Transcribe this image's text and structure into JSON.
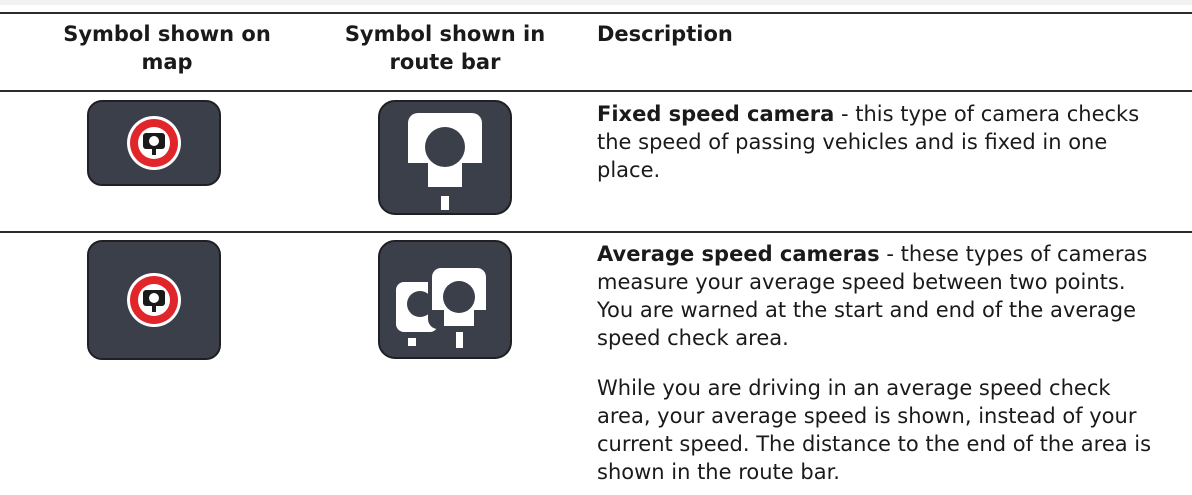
{
  "table": {
    "headers": {
      "map_symbol": "Symbol shown on map",
      "route_bar_symbol": "Symbol shown in route bar",
      "description": "Description"
    },
    "rows": [
      {
        "map_icon": "fixed-speed-camera-map-icon",
        "route_bar_icon": "fixed-speed-camera-route-bar-icon",
        "title": "Fixed speed camera",
        "text": " - this type of camera checks the speed of passing vehicles and is fixed in one place."
      },
      {
        "map_icon": "average-speed-camera-map-icon",
        "route_bar_icon": "average-speed-cameras-route-bar-icon",
        "title": "Average speed cameras",
        "text": " - these types of cameras measure your average speed between two points. You are warned at the start and end of the average speed check area.",
        "extra": "While you are driving in an average speed check area, your average speed is shown, instead of your current speed. The distance to the end of the area is shown in the route bar."
      }
    ]
  },
  "colors": {
    "tile": "#3b3f49",
    "tile_border": "#1f1f24",
    "sign_red": "#e1262b",
    "white": "#ffffff"
  }
}
